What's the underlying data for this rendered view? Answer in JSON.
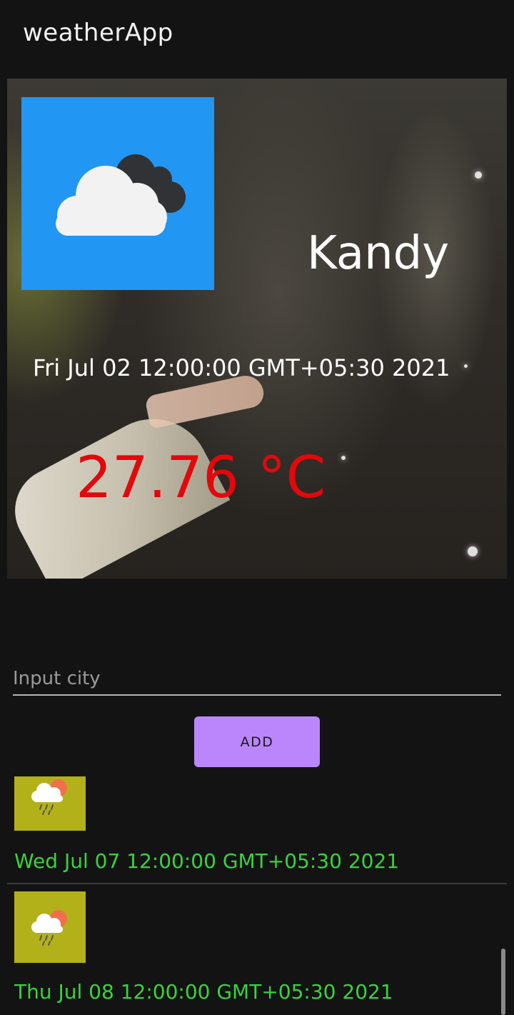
{
  "app_bar": {
    "title": "weatherApp"
  },
  "current": {
    "city": "Kandy",
    "date": "Fri Jul 02 12:00:00 GMT+05:30 2021",
    "temperature": "27.76 °C",
    "icon": "cloud-icon",
    "icon_bg": "#2196f3"
  },
  "search": {
    "placeholder": "Input city",
    "value": "",
    "add_label": "ADD"
  },
  "forecast": [
    {
      "date": "Wed Jul 07 12:00:00 GMT+05:30 2021",
      "icon": "rain-sun-icon"
    },
    {
      "date": "Thu Jul 08 12:00:00 GMT+05:30 2021",
      "icon": "rain-sun-icon"
    }
  ],
  "colors": {
    "temperature": "#e2080b",
    "forecast_text": "#38d33c",
    "button": "#bb86fc",
    "thumb_bg": "#b3b11a"
  }
}
